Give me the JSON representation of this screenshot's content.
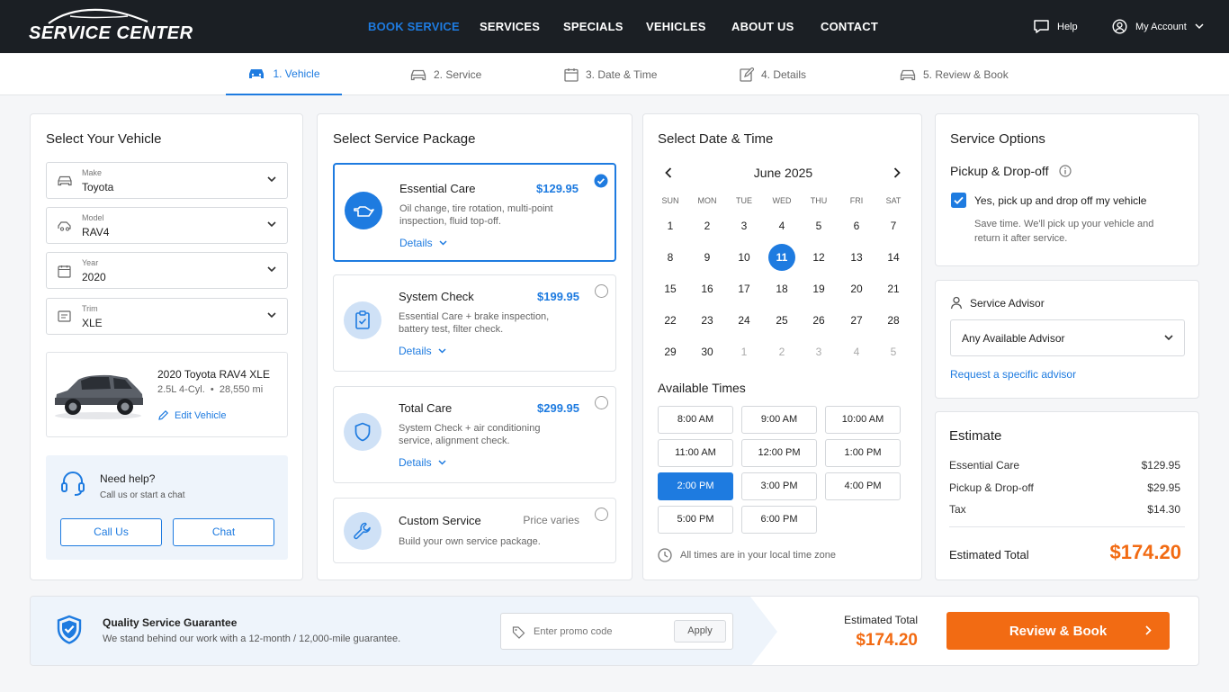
{
  "brand": {
    "name": "SERVICE CENTER"
  },
  "nav": {
    "items": [
      {
        "label": "BOOK SERVICE",
        "active": true
      },
      {
        "label": "SERVICES"
      },
      {
        "label": "SPECIALS"
      },
      {
        "label": "VEHICLES"
      },
      {
        "label": "ABOUT US"
      },
      {
        "label": "CONTACT"
      }
    ],
    "help": "Help",
    "account": "My Account"
  },
  "steps": [
    {
      "label": "1. Vehicle",
      "icon": "car-icon",
      "active": true
    },
    {
      "label": "2. Service",
      "icon": "car-icon"
    },
    {
      "label": "3. Date & Time",
      "icon": "calendar-icon"
    },
    {
      "label": "4. Details",
      "icon": "edit-icon"
    },
    {
      "label": "5. Review & Book",
      "icon": "car-icon"
    }
  ],
  "vehicle": {
    "title": "Select Your Vehicle",
    "fields": [
      {
        "label": "Make",
        "value": "Toyota",
        "icon": "car-icon"
      },
      {
        "label": "Model",
        "value": "RAV4",
        "icon": "car-side-icon"
      },
      {
        "label": "Year",
        "value": "2020",
        "icon": "calendar-icon"
      },
      {
        "label": "Trim",
        "value": "XLE",
        "icon": "id-card-icon"
      }
    ],
    "summary": {
      "name": "2020 Toyota RAV4 XLE",
      "specs": "2.5L 4-Cyl.  •  28,550 mi",
      "edit": "Edit Vehicle"
    },
    "help": {
      "title": "Need help?",
      "subtitle": "Call us or start a chat",
      "call": "Call Us",
      "chat": "Chat"
    }
  },
  "packages": {
    "title": "Select Service Package",
    "items": [
      {
        "name": "Essential Care",
        "price": "$129.95",
        "desc": "Oil change, tire rotation, multi-point inspection, fluid top-off.",
        "details": "Details",
        "selected": true
      },
      {
        "name": "System Check",
        "price": "$199.95",
        "desc": "Essential Care + brake inspection, battery test, filter check.",
        "details": "Details"
      },
      {
        "name": "Total Care",
        "price": "$299.95",
        "desc": "System Check + air conditioning service, alignment check.",
        "details": "Details"
      },
      {
        "name": "Custom Service",
        "price": "Price varies",
        "desc": "Build your own service package."
      }
    ]
  },
  "calendar": {
    "title": "Select Date & Time",
    "month": "June 2025",
    "dow": [
      "SUN",
      "MON",
      "TUE",
      "WED",
      "THU",
      "FRI",
      "SAT"
    ],
    "weeks": [
      [
        "1",
        "2",
        "3",
        "4",
        "5",
        "6",
        "7"
      ],
      [
        "8",
        "9",
        "10",
        "11",
        "12",
        "13",
        "14"
      ],
      [
        "15",
        "16",
        "17",
        "18",
        "19",
        "20",
        "21"
      ],
      [
        "22",
        "23",
        "24",
        "25",
        "26",
        "27",
        "28"
      ],
      [
        "29",
        "30",
        "1",
        "2",
        "3",
        "4",
        "5"
      ]
    ],
    "selected_day": "11",
    "times_title": "Available Times",
    "times": [
      "8:00 AM",
      "9:00 AM",
      "10:00 AM",
      "11:00 AM",
      "12:00 PM",
      "1:00 PM",
      "2:00 PM",
      "3:00 PM",
      "4:00 PM",
      "5:00 PM",
      "6:00 PM"
    ],
    "selected_time": "2:00 PM",
    "tz_note": "All times are in your local time zone"
  },
  "options": {
    "title": "Service Options",
    "pickup_title": "Pickup & Drop-off",
    "pickup_check": "Yes, pick up and drop off my vehicle",
    "pickup_note": "Save time. We'll pick up your vehicle and return it after service.",
    "advisor_title": "Service Advisor",
    "advisor_value": "Any Available Advisor",
    "advisor_link": "Request a specific advisor"
  },
  "estimate": {
    "title": "Estimate",
    "rows": [
      {
        "label": "Essential Care",
        "value": "$129.95"
      },
      {
        "label": "Pickup & Drop-off",
        "value": "$29.95"
      },
      {
        "label": "Tax",
        "value": "$14.30"
      }
    ],
    "total_label": "Estimated Total",
    "total": "$174.20"
  },
  "footer": {
    "guarantee_title": "Quality Service Guarantee",
    "guarantee_text": "We stand behind our work with a 12-month / 12,000-mile guarantee.",
    "promo_placeholder": "Enter promo code",
    "apply": "Apply",
    "total_label": "Estimated Total",
    "total": "$174.20",
    "cta": "Review & Book"
  },
  "colors": {
    "accent": "#1e7be0",
    "cta": "#f26b13",
    "topbar": "#1b1f24"
  }
}
